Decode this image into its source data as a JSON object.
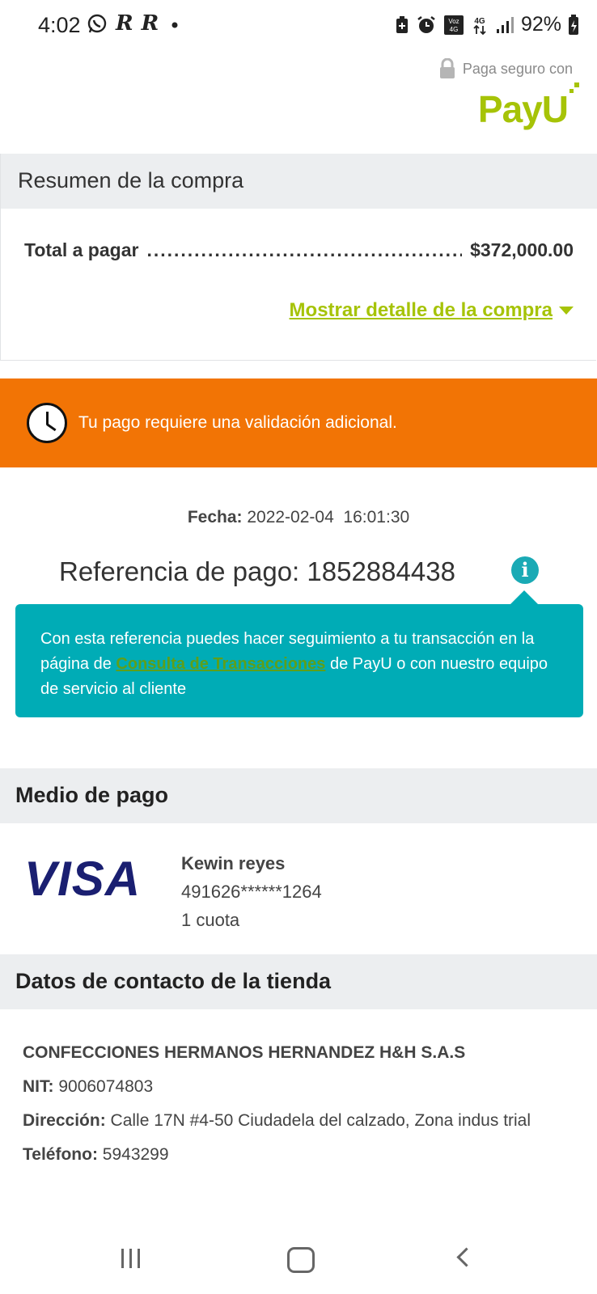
{
  "status_bar": {
    "time": "4:02",
    "left_icons": [
      "whatsapp-icon",
      "r-app-icon",
      "r-app-icon",
      "dot-icon"
    ],
    "right_icons": [
      "battery-saver-icon",
      "alarm-icon",
      "volte-icon",
      "4g-icon",
      "signal-icon"
    ],
    "battery": "92%"
  },
  "header": {
    "secure_text": "Paga seguro con",
    "logo_text": "PayU",
    "brand_color": "#a6c307"
  },
  "summary": {
    "title": "Resumen de la compra",
    "total_label": "Total a pagar",
    "total_value": "$372,000.00",
    "detail_link": "Mostrar detalle de la compra"
  },
  "alert": {
    "text": "Tu pago requiere una validación adicional.",
    "color": "#f27405"
  },
  "transaction": {
    "date_label": "Fecha:",
    "date_value": "2022-02-04  16:01:30",
    "reference_label": "Referencia de pago:",
    "reference_value": "1852884438",
    "info_icon_glyph": "i",
    "tooltip_part1": "Con esta referencia puedes hacer seguimiento a tu transacción en la página de ",
    "tooltip_link": "Consulta de Transacciones",
    "tooltip_part2": " de PayU o con nuestro equipo de servicio al cliente",
    "tooltip_color": "#00acb6"
  },
  "payment_method": {
    "title": "Medio de pago",
    "card_brand": "VISA",
    "holder": "Kewin reyes",
    "card_number": "491626******1264",
    "installments": "1 cuota"
  },
  "store": {
    "title": "Datos de contacto de la tienda",
    "name": "CONFECCIONES HERMANOS HERNANDEZ H&H S.A.S",
    "nit_label": "NIT:",
    "nit_value": "9006074803",
    "address_label": "Dirección:",
    "address_value": "Calle 17N #4-50 Ciudadela del calzado, Zona indus trial",
    "phone_label": "Teléfono:",
    "phone_value": "5943299"
  },
  "nav": {
    "recent": "recent-apps-icon",
    "home": "home-icon",
    "back": "back-icon"
  }
}
